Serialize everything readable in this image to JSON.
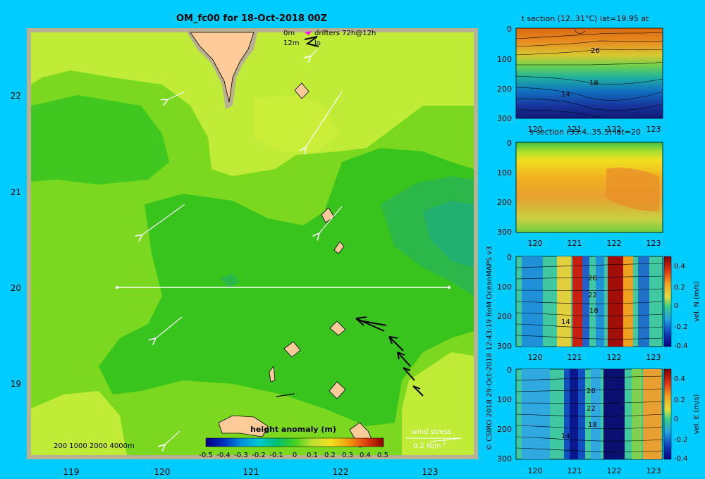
{
  "title": "OM_fc00 for 18-Oct-2018 00Z",
  "legend": {
    "line1_depth": "0m",
    "line1_label": "drifters 72h@12h",
    "line2_depth": "12m",
    "line2_label": "lo"
  },
  "map": {
    "x_ticks": [
      "119",
      "120",
      "121",
      "122",
      "123"
    ],
    "y_ticks": [
      "22",
      "21",
      "20",
      "19"
    ],
    "depth_contours": "200  1000  2000  4000m",
    "wind_label": "wind stress",
    "wind_scale": "0.2 N/m",
    "wind_scale_exp": "2"
  },
  "colorbar": {
    "title": "height anomaly (m)",
    "ticks": [
      "-0.5",
      "-0.4",
      "-0.3",
      "-0.2",
      "-0.1",
      "0",
      "0.1",
      "0.2",
      "0.3",
      "0.4",
      "0.5"
    ]
  },
  "copyright": "© CSIRO 2018   29-Oct-2018 12:43:19 BoM OceanMAPS v3",
  "panels": [
    {
      "title": "t section (12..31°C) lat=19.95 at",
      "y_ticks": [
        "0",
        "100",
        "200",
        "300"
      ],
      "x_ticks": [
        "120",
        "121",
        "122",
        "123"
      ],
      "contour_labels": [
        "26",
        "18",
        "14"
      ]
    },
    {
      "title": "s section (33.4..35.5) lat=20",
      "y_ticks": [
        "0",
        "100",
        "200",
        "300"
      ],
      "x_ticks": [
        "120",
        "121",
        "122",
        "123"
      ],
      "contour_labels": []
    },
    {
      "title": "",
      "y_ticks": [
        "0",
        "100",
        "200",
        "300"
      ],
      "x_ticks": [
        "120",
        "121",
        "122",
        "123"
      ],
      "contour_labels": [
        "26",
        "22",
        "18",
        "14"
      ],
      "cbar_ticks": [
        "0.4",
        "0.2",
        "0",
        "-0.2",
        "-0.4"
      ],
      "cbar_label": "vel. N (m/s)"
    },
    {
      "title": "",
      "y_ticks": [
        "0",
        "100",
        "200",
        "300"
      ],
      "x_ticks": [
        "120",
        "121",
        "122",
        "123"
      ],
      "contour_labels": [
        "26",
        "22",
        "18",
        "14"
      ],
      "cbar_ticks": [
        "0.4",
        "0.2",
        "0",
        "-0.2",
        "-0.4"
      ],
      "cbar_label": "vel. E (m/s)"
    }
  ]
}
